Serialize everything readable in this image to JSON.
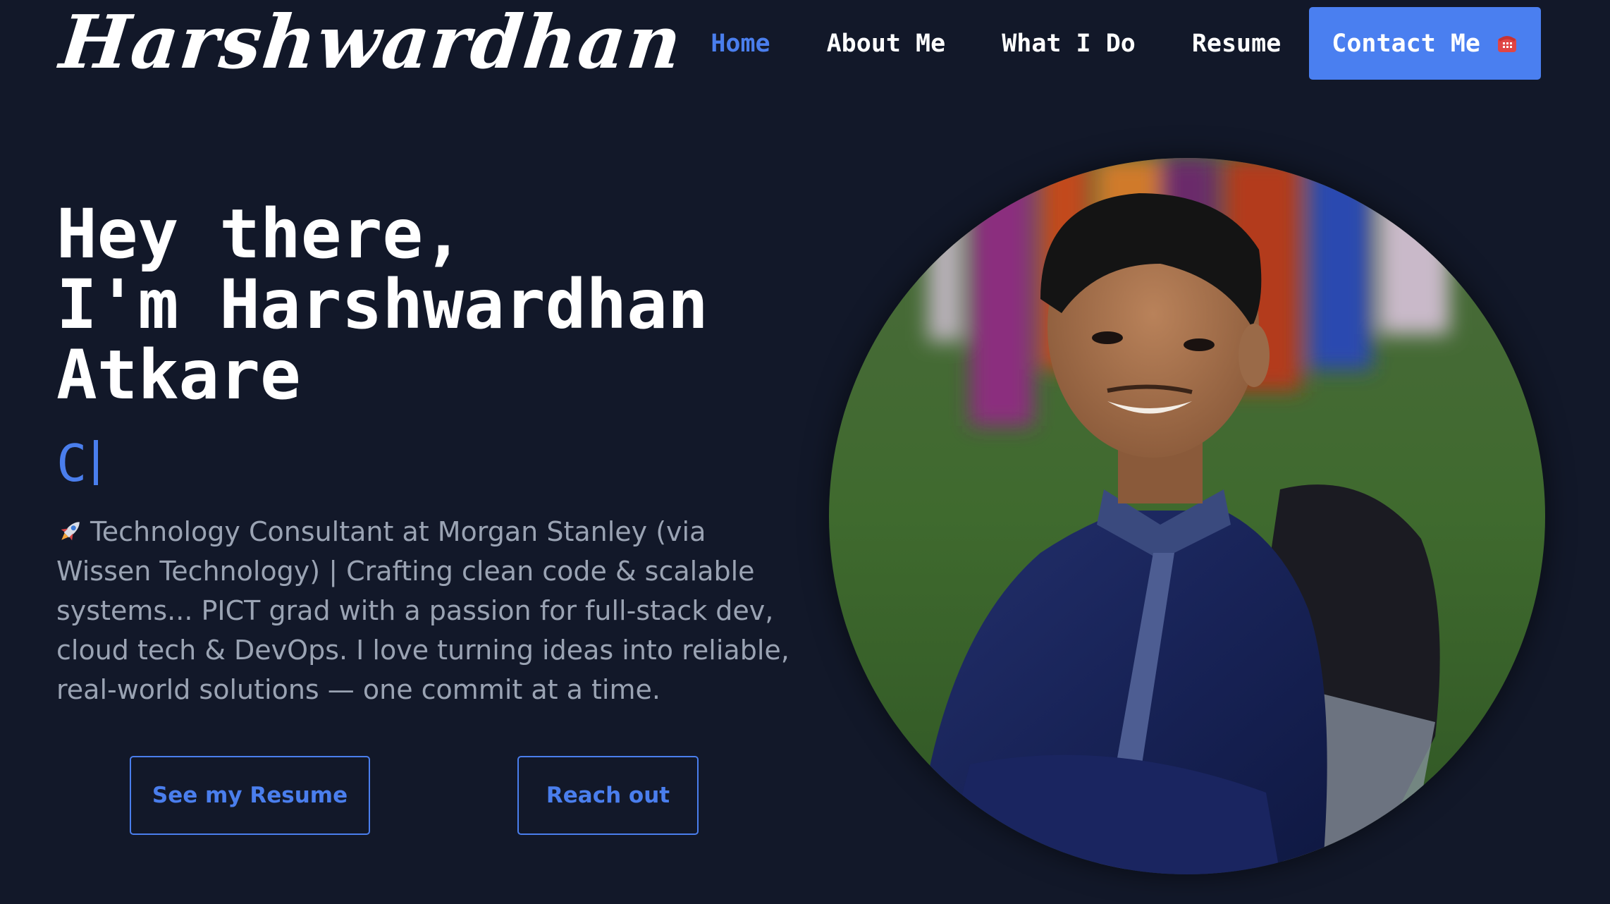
{
  "brand": {
    "logo_text": "Harshwardhan"
  },
  "nav": {
    "items": [
      {
        "label": "Home",
        "active": true
      },
      {
        "label": "About Me",
        "active": false
      },
      {
        "label": "What I Do",
        "active": false
      },
      {
        "label": "Resume",
        "active": false
      }
    ],
    "contact_label": "Contact Me",
    "contact_icon": "telephone-icon"
  },
  "hero": {
    "title_line1": "Hey there,",
    "title_line2": "I'm Harshwardhan",
    "title_line3": "Atkare",
    "typing_text": "C",
    "bio_icon": "rocket-icon",
    "bio": "Technology Consultant at Morgan Stanley (via Wissen Technology) | Crafting clean code & scalable systems... PICT grad with a passion for full-stack dev, cloud tech & DevOps. I love turning ideas into reliable, real-world solutions — one commit at a time.",
    "resume_button": "See my Resume",
    "reach_button": "Reach out",
    "photo": "profile-photo"
  },
  "colors": {
    "background": "#121829",
    "accent": "#4a7eed",
    "text": "#ffffff",
    "muted_text": "#9aa3b3"
  }
}
